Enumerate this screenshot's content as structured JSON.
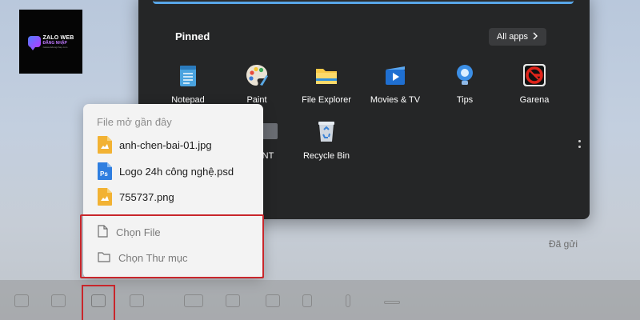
{
  "logo": {
    "line1": "ZALO WEB",
    "line2": "ĐĂNG NHẬP",
    "line3": "zalowebdangnhap.com"
  },
  "start_menu": {
    "pinned_title": "Pinned",
    "all_apps_label": "All apps",
    "all_apps_icon": "chevron-right-icon",
    "apps": [
      {
        "label": "Notepad",
        "icon": "notepad-icon"
      },
      {
        "label": "Paint",
        "icon": "paint-palette-icon"
      },
      {
        "label": "File Explorer",
        "icon": "folder-icon"
      },
      {
        "label": "Movies & TV",
        "icon": "movies-tv-icon"
      },
      {
        "label": "Tips",
        "icon": "lightbulb-icon"
      },
      {
        "label": "Garena",
        "icon": "garena-icon"
      }
    ],
    "apps_row2": [
      {
        "label": "NT",
        "icon": "app-icon"
      },
      {
        "label": "Recycle Bin",
        "icon": "recycle-bin-icon"
      }
    ]
  },
  "context_menu": {
    "title": "File mở gần đây",
    "recent_files": [
      {
        "name": "anh-chen-bai-01.jpg",
        "icon": "image-file-icon"
      },
      {
        "name": "Logo 24h công nghệ.psd",
        "icon": "photoshop-file-icon"
      },
      {
        "name": "755737.png",
        "icon": "image-file-icon"
      }
    ],
    "choose_file_label": "Chọn File",
    "choose_folder_label": "Chọn Thư mục"
  },
  "chat": {
    "sent_status": "Đã gửi"
  },
  "colors": {
    "start_menu_bg": "#252627",
    "accent_blue": "#58a6e8",
    "highlight_red": "#c8262b",
    "menu_bg": "#f3f3f3"
  }
}
